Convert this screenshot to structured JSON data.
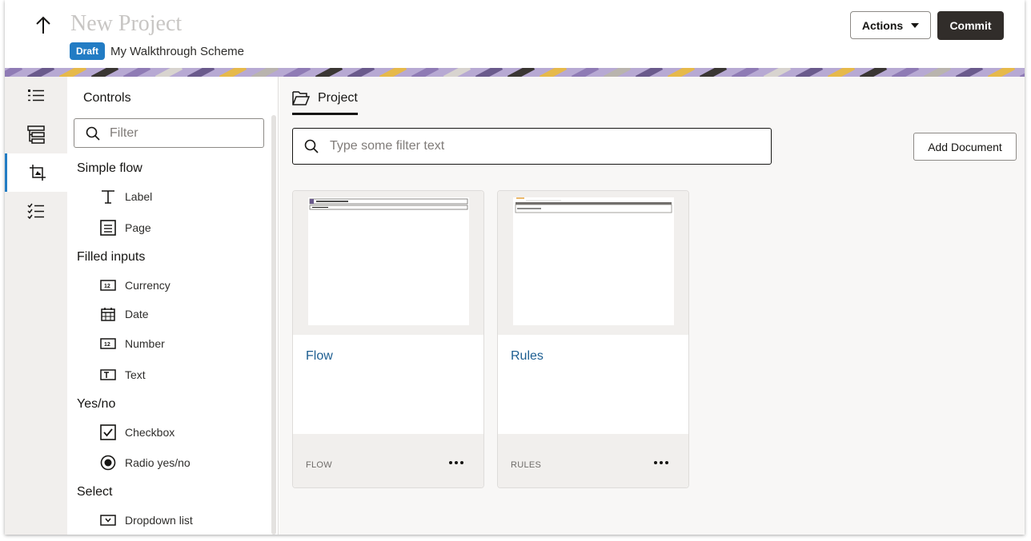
{
  "header": {
    "title": "New Project",
    "status_badge": "Draft",
    "scheme_name": "My Walkthrough Scheme",
    "actions_label": "Actions",
    "commit_label": "Commit"
  },
  "rail": {
    "items": [
      {
        "icon": "list-icon",
        "active": false
      },
      {
        "icon": "tree-icon",
        "active": false
      },
      {
        "icon": "crop-icon",
        "active": true
      },
      {
        "icon": "checklist-icon",
        "active": false
      }
    ]
  },
  "controls": {
    "title": "Controls",
    "filter_placeholder": "Filter",
    "groups": [
      {
        "label": "Simple flow",
        "items": [
          {
            "label": "Label",
            "icon": "text-t-icon"
          },
          {
            "label": "Page",
            "icon": "page-icon"
          }
        ]
      },
      {
        "label": "Filled inputs",
        "items": [
          {
            "label": "Currency",
            "icon": "number-field-icon"
          },
          {
            "label": "Date",
            "icon": "calendar-icon"
          },
          {
            "label": "Number",
            "icon": "number-field-icon"
          },
          {
            "label": "Text",
            "icon": "text-field-icon"
          }
        ]
      },
      {
        "label": "Yes/no",
        "items": [
          {
            "label": "Checkbox",
            "icon": "checkbox-icon"
          },
          {
            "label": "Radio yes/no",
            "icon": "radio-icon"
          }
        ]
      },
      {
        "label": "Select",
        "items": [
          {
            "label": "Dropdown list",
            "icon": "dropdown-icon"
          }
        ]
      }
    ]
  },
  "main": {
    "tab_label": "Project",
    "search_placeholder": "Type some filter text",
    "add_document_label": "Add Document",
    "documents": [
      {
        "name": "Flow",
        "type": "FLOW"
      },
      {
        "name": "Rules",
        "type": "RULES"
      }
    ]
  },
  "colors": {
    "accent": "#227cc4",
    "commit_bg": "#312d2a",
    "link": "#1d5e91",
    "banner_purple": "#8f7bb5",
    "banner_yellow": "#e6b94a"
  }
}
